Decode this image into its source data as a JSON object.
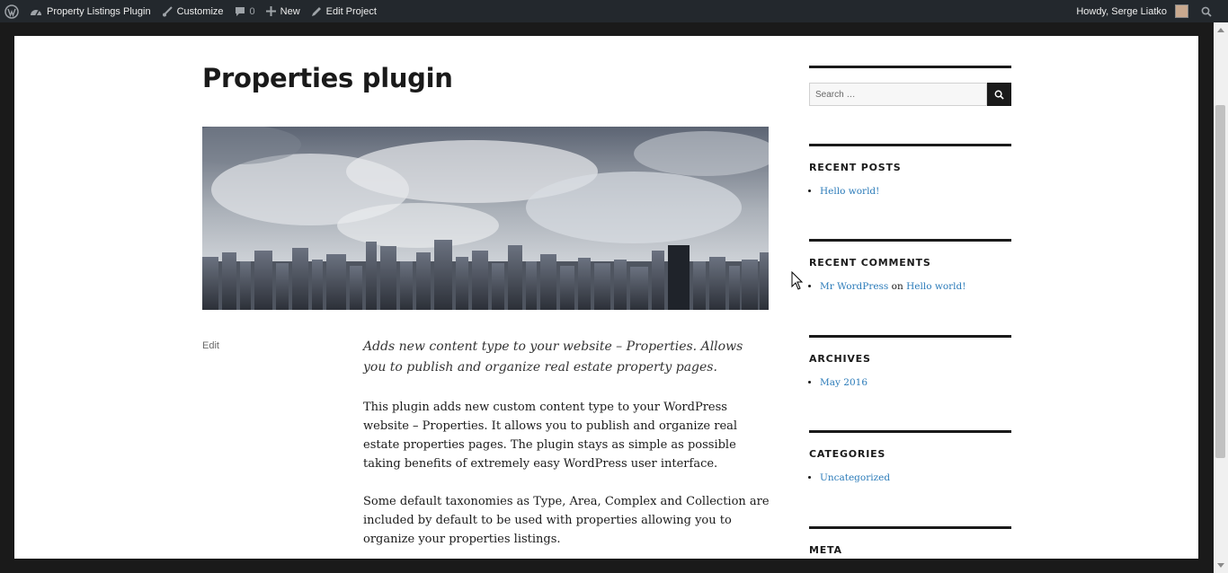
{
  "adminbar": {
    "site_name": "Property Listings Plugin",
    "customize": "Customize",
    "comments_count": "0",
    "new_label": "New",
    "edit_label": "Edit Project",
    "howdy": "Howdy, Serge Liatko"
  },
  "post": {
    "title": "Properties plugin",
    "edit": "Edit",
    "lead": "Adds new content type to your website – Properties. Allows you to publish and organize real estate property pages.",
    "paragraphs": [
      "This plugin adds new custom content type to your WordPress website – Properties. It allows you to publish and organize real estate properties pages. The plugin stays as simple as possible taking benefits of extremely easy WordPress user interface.",
      "Some default taxonomies as Type, Area, Complex and Collection are included by default to be used with properties allowing you to organize your properties listings."
    ]
  },
  "sidebar": {
    "search_placeholder": "Search …",
    "recent_posts": {
      "title": "RECENT POSTS",
      "items": [
        "Hello world!"
      ]
    },
    "recent_comments": {
      "title": "RECENT COMMENTS",
      "author": "Mr WordPress",
      "on": "on",
      "post": "Hello world!"
    },
    "archives": {
      "title": "ARCHIVES",
      "items": [
        "May 2016"
      ]
    },
    "categories": {
      "title": "CATEGORIES",
      "items": [
        "Uncategorized"
      ]
    },
    "meta": {
      "title": "META"
    }
  },
  "colors": {
    "link": "#2b7bb9",
    "adminbar": "#23282d"
  }
}
